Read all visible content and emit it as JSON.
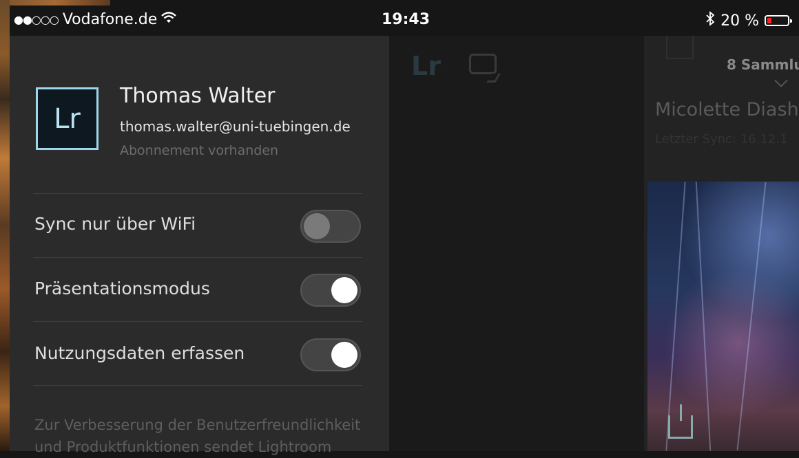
{
  "status_bar": {
    "signal": "●●○○○",
    "carrier": "Vodafone.de",
    "wifi_icon": "wifi-icon",
    "time": "19:43",
    "bluetooth_icon": "bluetooth-icon",
    "battery_text": "20 %",
    "battery_level": 0.2,
    "battery_color": "#ff2020"
  },
  "drawer": {
    "logo_text": "Lr",
    "user_name": "Thomas Walter",
    "user_email": "thomas.walter@uni-tuebingen.de",
    "subscription": "Abonnement vorhanden",
    "settings": [
      {
        "label": "Sync nur über WiFi",
        "enabled": false
      },
      {
        "label": "Präsentationsmodus",
        "enabled": true
      },
      {
        "label": "Nutzungsdaten erfassen",
        "enabled": true
      }
    ],
    "footer": "Zur Verbesserung der Benutzerfreundlichkeit und Produktfunktionen sendet Lightroom"
  },
  "app": {
    "logo_text": "Lr",
    "collections_label": "8 Sammlu",
    "album_title": "Micolette Diasho",
    "album_sync": "Letzter Sync: 16.12.1"
  }
}
